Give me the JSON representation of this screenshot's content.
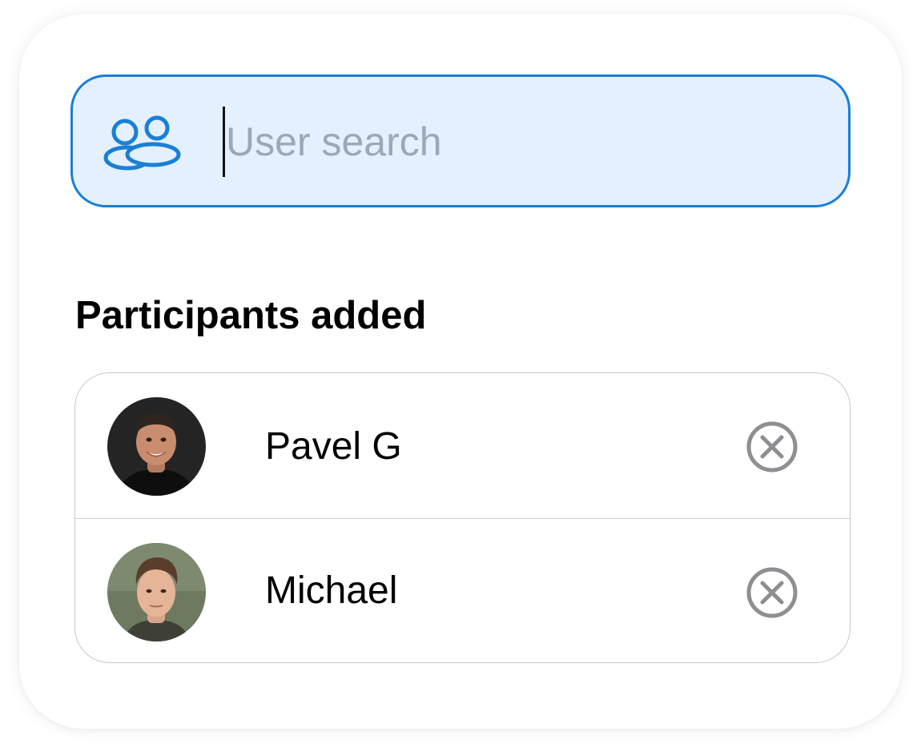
{
  "search": {
    "placeholder": "User search",
    "value": "",
    "icon": "users-icon",
    "accent_color": "#1a7fd6",
    "background_color": "#e4f0fd"
  },
  "participants": {
    "title": "Participants added",
    "items": [
      {
        "name": "Pavel G",
        "avatar": "avatar-photo",
        "remove_icon": "remove-circle-x-icon"
      },
      {
        "name": "Michael",
        "avatar": "avatar-photo",
        "remove_icon": "remove-circle-x-icon"
      }
    ]
  }
}
